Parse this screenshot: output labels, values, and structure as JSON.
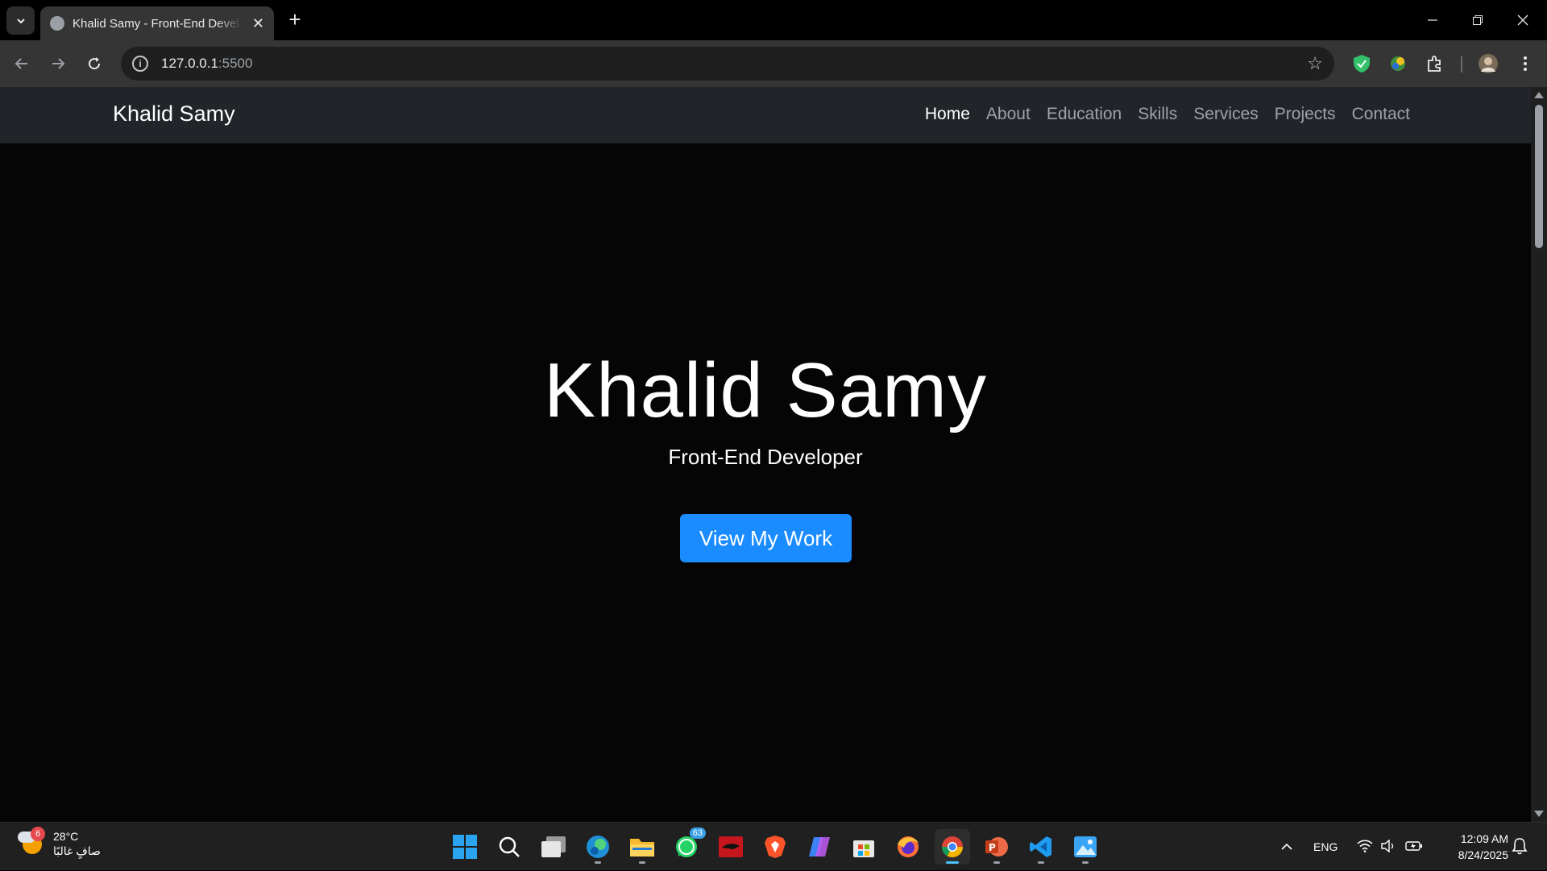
{
  "browser": {
    "tab_title": "Khalid Samy - Front-End Developer",
    "url_host": "127.0.0.1",
    "url_port": ":5500"
  },
  "site": {
    "brand": "Khalid Samy",
    "nav": [
      {
        "label": "Home",
        "active": true
      },
      {
        "label": "About"
      },
      {
        "label": "Education"
      },
      {
        "label": "Skills"
      },
      {
        "label": "Services"
      },
      {
        "label": "Projects"
      },
      {
        "label": "Contact"
      }
    ],
    "hero": {
      "title": "Khalid Samy",
      "subtitle": "Front-End Developer",
      "button": "View My Work"
    }
  },
  "taskbar": {
    "weather_badge": "6",
    "temperature": "28°C",
    "condition": "صافٍ غالبًا",
    "whatsapp_badge": "63",
    "language": "ENG",
    "time": "12:09 AM",
    "date": "8/24/2025"
  },
  "colors": {
    "accent": "#1a8cff",
    "nav_bg": "#212529",
    "page_bg": "#050505"
  }
}
